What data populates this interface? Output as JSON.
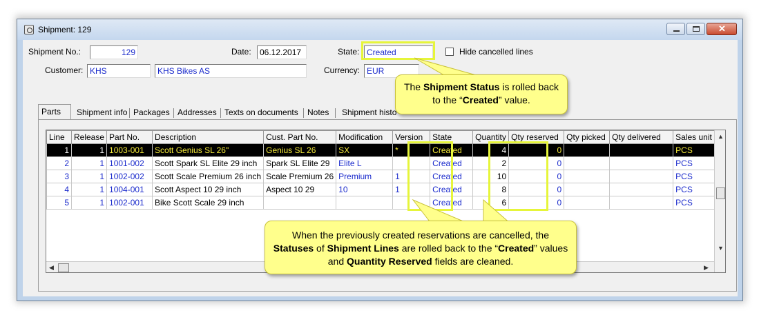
{
  "window": {
    "title": "Shipment: 129"
  },
  "header": {
    "shipment_no_label": "Shipment No.:",
    "shipment_no": "129",
    "date_label": "Date:",
    "date": "06.12.2017",
    "state_label": "State:",
    "state": "Created",
    "hide_cancelled_label": "Hide cancelled lines",
    "customer_label": "Customer:",
    "customer_code": "KHS",
    "customer_name": "KHS Bikes AS",
    "currency_label": "Currency:",
    "currency": "EUR"
  },
  "tabs": [
    "Parts",
    "Shipment info",
    "Packages",
    "Addresses",
    "Texts on documents",
    "Notes",
    "Shipment histo"
  ],
  "table": {
    "columns": [
      "Line",
      "Release",
      "Part No.",
      "Description",
      "Cust. Part No.",
      "Modification",
      "Version",
      "State",
      "Quantity",
      "Qty reserved",
      "Qty picked",
      "Qty delivered",
      "Sales unit"
    ],
    "rows": [
      [
        "1",
        "1",
        "1003-001",
        "Scott Genius SL 26\"",
        "Genius SL 26",
        "SX",
        "*",
        "Created",
        "4",
        "0",
        "",
        "",
        "PCS"
      ],
      [
        "2",
        "1",
        "1001-002",
        "Scott Spark SL Elite 29 inch",
        "Spark SL Elite 29",
        "Elite L",
        "",
        "Created",
        "2",
        "0",
        "",
        "",
        "PCS"
      ],
      [
        "3",
        "1",
        "1002-002",
        "Scott Scale Premium 26 inch",
        "Scale Premium 26",
        "Premium",
        "1",
        "Created",
        "10",
        "0",
        "",
        "",
        "PCS"
      ],
      [
        "4",
        "1",
        "1004-001",
        "Scott Aspect 10 29 inch",
        "Aspect 10 29",
        "10",
        "1",
        "Created",
        "8",
        "0",
        "",
        "",
        "PCS"
      ],
      [
        "5",
        "1",
        "1002-001",
        "Bike Scott Scale 29 inch",
        "",
        "",
        "",
        "Created",
        "6",
        "0",
        "",
        "",
        "PCS"
      ]
    ]
  },
  "callouts": {
    "top": {
      "p1": "The ",
      "b1": "Shipment Status",
      "p2": " is rolled back to the “",
      "b2": "Created",
      "p3": "” value."
    },
    "bottom": {
      "p1": "When the previously created reservations are cancelled, the ",
      "b1": "Statuses",
      "p2": " of ",
      "b2": "Shipment Lines",
      "p3": " are rolled back to the “",
      "b3": "Created",
      "p4": "” values and ",
      "b4": "Quantity Reserved",
      "p5": " fields are cleaned."
    }
  },
  "colors": {
    "highlight": "#e6f53a",
    "callout_bg": "#ffff8c",
    "link_text": "#1b2bcc"
  }
}
